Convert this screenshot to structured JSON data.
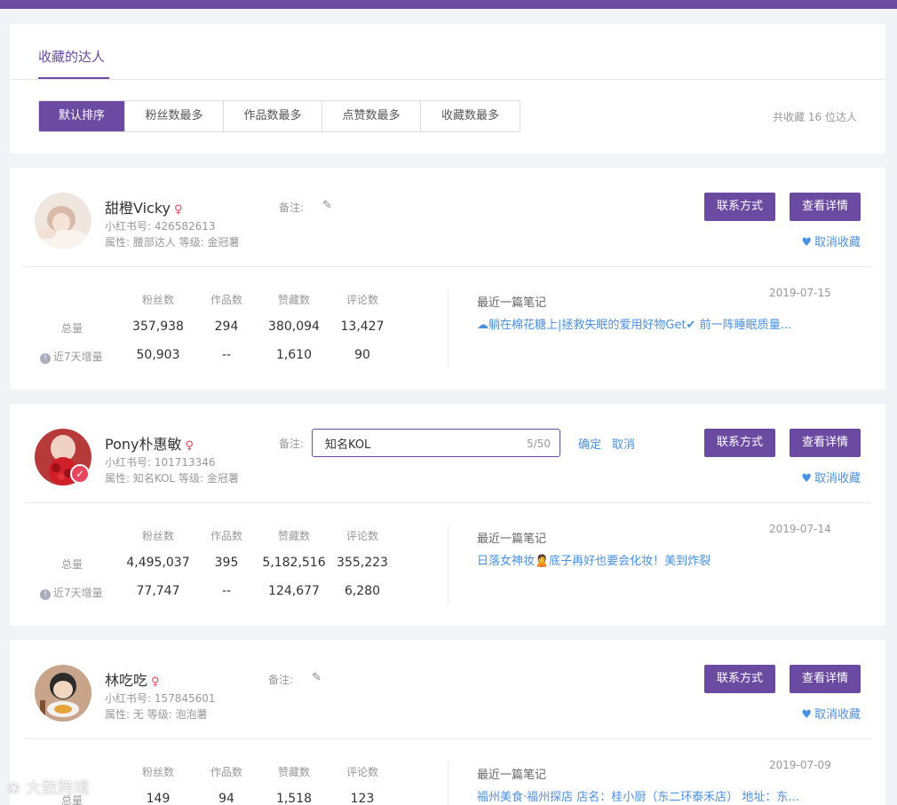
{
  "header": {
    "tab_title": "收藏的达人",
    "sort_options": [
      "默认排序",
      "粉丝数最多",
      "作品数最多",
      "点赞数最多",
      "收藏数最多"
    ],
    "total_text": "共收藏 16 位达人"
  },
  "labels": {
    "note": "备注:",
    "contact": "联系方式",
    "detail": "查看详情",
    "unfav": "取消收藏",
    "col_fans": "粉丝数",
    "col_works": "作品数",
    "col_likes": "赞藏数",
    "col_comments": "评论数",
    "row_total": "总量",
    "row_week": "近7天增量",
    "recent": "最近一篇笔记",
    "confirm": "确定",
    "cancel": "取消"
  },
  "icons": {
    "edit": "pencil-icon",
    "heart": "heart-icon",
    "info": "info-icon",
    "gender": "female-icon",
    "verified": "check-badge-icon"
  },
  "colors": {
    "brand": "#6a4ba1",
    "link": "#4a90e2",
    "gender": "#e8465e"
  },
  "cards": [
    {
      "name": "甜橙Vicky",
      "xhs_id": "小红书号:  426582613",
      "attrs": "属性:  腰部达人    等级:  金冠薯",
      "stats_total": [
        "357,938",
        "294",
        "380,094",
        "13,427"
      ],
      "stats_week": [
        "50,903",
        "--",
        "1,610",
        "90"
      ],
      "recent_date": "2019-07-15",
      "recent_title": "☁躺在棉花糖上|拯救失眠的爱用好物Get✔ 前一阵睡眠质量..."
    },
    {
      "name": "Pony朴惠敏",
      "xhs_id": "小红书号:  101713346",
      "attrs": "属性:  知名KOL    等级:  金冠薯",
      "note_value": "知名KOL",
      "note_count": "5/50",
      "stats_total": [
        "4,495,037",
        "395",
        "5,182,516",
        "355,223"
      ],
      "stats_week": [
        "77,747",
        "--",
        "124,677",
        "6,280"
      ],
      "recent_date": "2019-07-14",
      "recent_title": "日落女神妆🙎底子再好也要会化妆！美到炸裂"
    },
    {
      "name": "林吃吃",
      "xhs_id": "小红书号:  157845601",
      "attrs": "属性:  无    等级:  泡泡薯",
      "stats_total": [
        "149",
        "94",
        "1,518",
        "123"
      ],
      "recent_date": "2019-07-09",
      "recent_title": "福州美食·福州探店 店名：桂小厨（东二环泰禾店） 地址：东..."
    }
  ],
  "watermark": "大数跨境"
}
